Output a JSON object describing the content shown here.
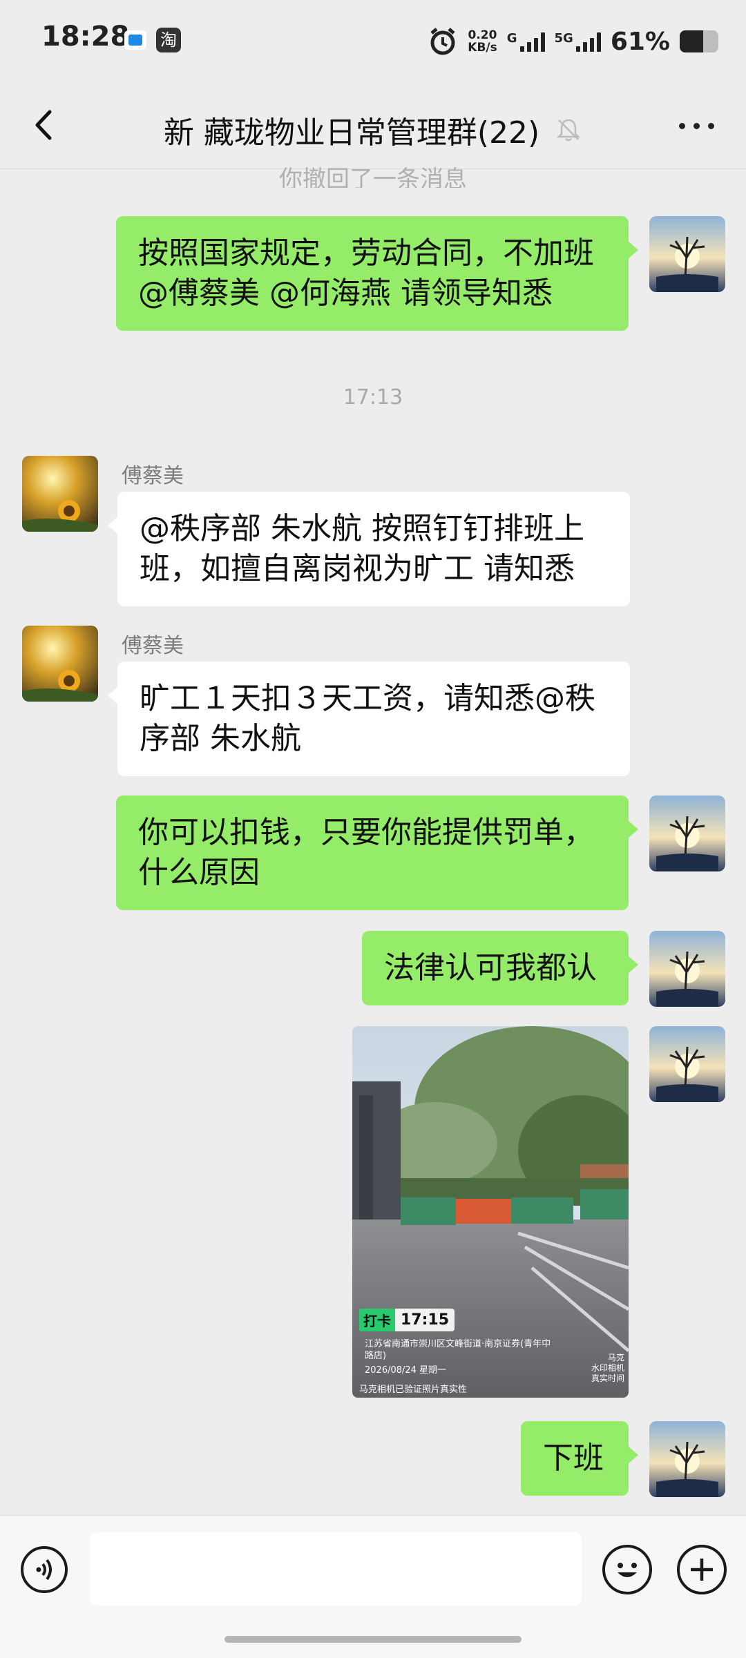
{
  "status_bar": {
    "time": "18:28",
    "app_icon_2": "淘",
    "net_speed_value": "0.20",
    "net_speed_unit": "KB/s",
    "net_type_1": "G",
    "net_type_2": "5G",
    "battery_percent": "61%",
    "battery_level": 0.61
  },
  "header": {
    "back_icon": "chevron-left-icon",
    "title": "新 藏珑物业日常管理群(22)",
    "mute_icon": "bell-muted-icon",
    "more_icon": "more-dots-icon"
  },
  "system_notice": "你撤回了一条消息",
  "timestamp": "17:13",
  "messages": [
    {
      "side": "mine",
      "lines": [
        "按照国家规定，劳动合同，不加班",
        "@傅蔡美 @何海燕  请领导知悉"
      ]
    },
    {
      "side": "theirs",
      "sender": "傅蔡美",
      "lines": [
        "@秩序部 朱水航  按照钉钉排班上",
        "班，如擅自离岗视为旷工 请知悉"
      ]
    },
    {
      "side": "theirs",
      "sender": "傅蔡美",
      "lines": [
        "旷工１天扣３天工资，请知悉@秩",
        "序部 朱水航"
      ]
    },
    {
      "side": "mine",
      "lines": [
        "你可以扣钱，只要你能提供罚单，",
        "什么原因"
      ]
    },
    {
      "side": "mine",
      "lines": [
        "法律认可我都认"
      ]
    },
    {
      "side": "mine",
      "type": "image",
      "photo": {
        "tag": "打卡",
        "time": "17:15",
        "address": "江苏省南通市崇川区文峰街道·南京证券(青年中路店)",
        "date": "2026/08/24  星期一",
        "verify": "马克相机已验证照片真实性",
        "watermark": "马克\n水印相机\n真实时间"
      }
    },
    {
      "side": "mine",
      "lines": [
        "下班"
      ]
    }
  ],
  "input_bar": {
    "voice_icon": "voice-icon",
    "mic_icon": "mic-icon",
    "emoji_icon": "emoji-icon",
    "plus_icon": "plus-icon",
    "input_value": ""
  },
  "colors": {
    "background": "#ededed",
    "mine_bubble": "#95ec69",
    "theirs_bubble": "#ffffff"
  }
}
